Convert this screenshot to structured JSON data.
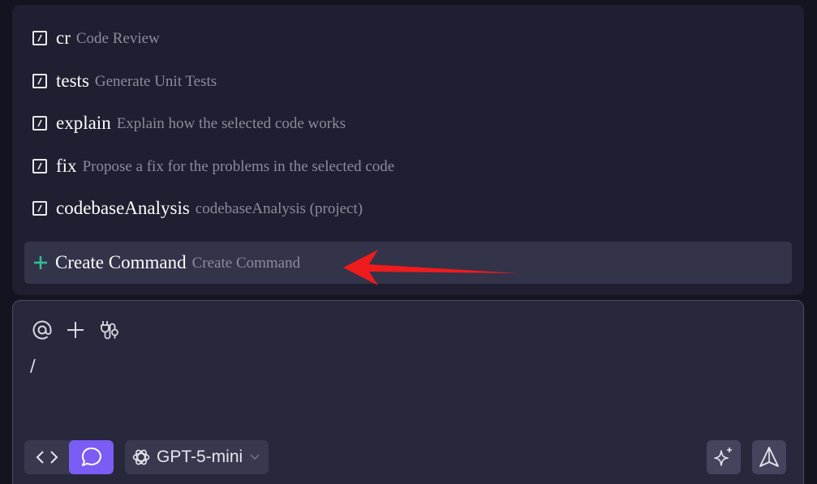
{
  "commands": [
    {
      "name": "cr",
      "description": "Code Review",
      "icon": "slash-command-icon"
    },
    {
      "name": "tests",
      "description": "Generate Unit Tests",
      "icon": "slash-command-icon"
    },
    {
      "name": "explain",
      "description": "Explain how the selected code works",
      "icon": "slash-command-icon"
    },
    {
      "name": "fix",
      "description": "Propose a fix for the problems in the selected code",
      "icon": "slash-command-icon"
    },
    {
      "name": "codebaseAnalysis",
      "description": "codebaseAnalysis (project)",
      "icon": "slash-command-icon"
    }
  ],
  "create_command": {
    "name": "Create Command",
    "description": "Create Command",
    "icon": "plus-icon",
    "icon_color": "#2fbf9a"
  },
  "annotation": {
    "type": "arrow",
    "color": "#ee1c1c",
    "points_to": "create_command"
  },
  "composer": {
    "toolbar": [
      "at-mention-icon",
      "plus-icon",
      "plug-icon"
    ],
    "input_value": "/",
    "modes": [
      {
        "icon": "code-icon",
        "active": false
      },
      {
        "icon": "chat-bubble-icon",
        "active": true
      }
    ],
    "model": {
      "label": "GPT-5-mini",
      "icon": "openai-logo-icon"
    },
    "actions": [
      "sparkle-icon",
      "send-icon"
    ]
  },
  "colors": {
    "accent": "#7b5cf5",
    "background": "#1f1f31",
    "panel": "#28283c"
  }
}
